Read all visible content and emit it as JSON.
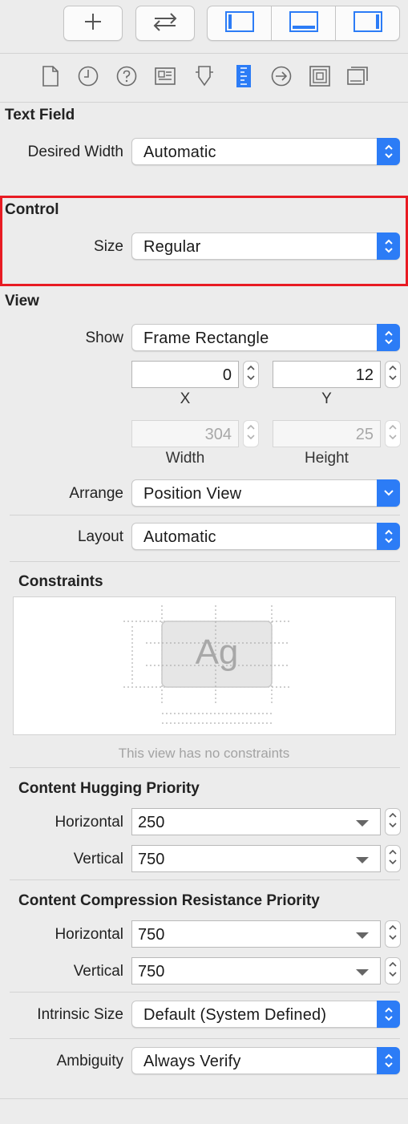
{
  "toolbar": {
    "add_icon": "plus-icon",
    "swap_icon": "swap-arrows-icon",
    "panels": [
      "left-panel-icon",
      "bottom-panel-icon",
      "right-panel-icon"
    ]
  },
  "inspector_tabs": [
    "file-icon",
    "history-icon",
    "help-icon",
    "identity-icon",
    "attributes-icon",
    "size-icon",
    "connections-icon",
    "bindings-icon",
    "effects-icon"
  ],
  "text_field": {
    "title": "Text Field",
    "desired_width_label": "Desired Width",
    "desired_width_value": "Automatic"
  },
  "control": {
    "title": "Control",
    "size_label": "Size",
    "size_value": "Regular"
  },
  "view": {
    "title": "View",
    "show_label": "Show",
    "show_value": "Frame Rectangle",
    "x_value": "0",
    "y_value": "12",
    "x_caption": "X",
    "y_caption": "Y",
    "width_value": "304",
    "height_value": "25",
    "width_caption": "Width",
    "height_caption": "Height",
    "arrange_label": "Arrange",
    "arrange_value": "Position View",
    "layout_label": "Layout",
    "layout_value": "Automatic"
  },
  "constraints": {
    "title": "Constraints",
    "preview_text": "Ag",
    "empty_hint": "This view has no constraints"
  },
  "hugging": {
    "title": "Content Hugging Priority",
    "horizontal_label": "Horizontal",
    "horizontal_value": "250",
    "vertical_label": "Vertical",
    "vertical_value": "750"
  },
  "compression": {
    "title": "Content Compression Resistance Priority",
    "horizontal_label": "Horizontal",
    "horizontal_value": "750",
    "vertical_label": "Vertical",
    "vertical_value": "750"
  },
  "intrinsic": {
    "label": "Intrinsic Size",
    "value": "Default (System Defined)"
  },
  "ambiguity": {
    "label": "Ambiguity",
    "value": "Always Verify"
  },
  "colors": {
    "accent": "#2c7cf6",
    "highlight": "#e81b23"
  }
}
